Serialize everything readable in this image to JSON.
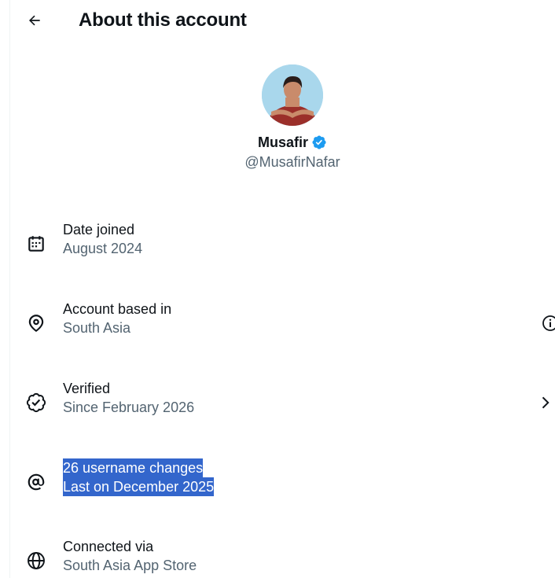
{
  "header": {
    "title": "About this account",
    "back_icon": "arrow-left-icon"
  },
  "profile": {
    "display_name": "Musafir",
    "handle": "@MusafirNafar",
    "verified_color": "#1d9bf0"
  },
  "rows": [
    {
      "icon": "calendar-icon",
      "title": "Date joined",
      "subtitle": "August 2024"
    },
    {
      "icon": "location-pin-icon",
      "title": "Account based in",
      "subtitle": "South Asia",
      "trailing_icon": "info-icon"
    },
    {
      "icon": "verified-seal-icon",
      "title": "Verified",
      "subtitle": "Since February 2026",
      "trailing_icon": "chevron-right-icon"
    },
    {
      "icon": "at-sign-icon",
      "title": "26 username changes",
      "subtitle": "Last on December 2025",
      "selected": true
    },
    {
      "icon": "globe-icon",
      "title": "Connected via",
      "subtitle": "South Asia App Store"
    }
  ],
  "colors": {
    "text_primary": "#0f1419",
    "text_secondary": "#536471",
    "selection": "#3366cc"
  }
}
